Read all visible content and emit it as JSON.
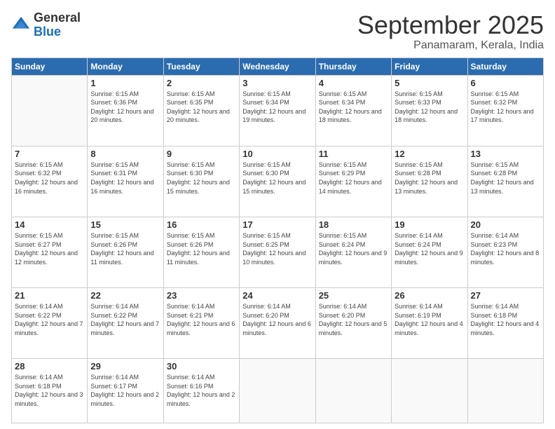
{
  "logo": {
    "general": "General",
    "blue": "Blue"
  },
  "header": {
    "month": "September 2025",
    "location": "Panamaram, Kerala, India"
  },
  "days_of_week": [
    "Sunday",
    "Monday",
    "Tuesday",
    "Wednesday",
    "Thursday",
    "Friday",
    "Saturday"
  ],
  "weeks": [
    [
      {
        "day": "",
        "info": ""
      },
      {
        "day": "1",
        "sunrise": "6:15 AM",
        "sunset": "6:36 PM",
        "daylight": "12 hours and 20 minutes."
      },
      {
        "day": "2",
        "sunrise": "6:15 AM",
        "sunset": "6:35 PM",
        "daylight": "12 hours and 20 minutes."
      },
      {
        "day": "3",
        "sunrise": "6:15 AM",
        "sunset": "6:34 PM",
        "daylight": "12 hours and 19 minutes."
      },
      {
        "day": "4",
        "sunrise": "6:15 AM",
        "sunset": "6:34 PM",
        "daylight": "12 hours and 18 minutes."
      },
      {
        "day": "5",
        "sunrise": "6:15 AM",
        "sunset": "6:33 PM",
        "daylight": "12 hours and 18 minutes."
      },
      {
        "day": "6",
        "sunrise": "6:15 AM",
        "sunset": "6:32 PM",
        "daylight": "12 hours and 17 minutes."
      }
    ],
    [
      {
        "day": "7",
        "sunrise": "6:15 AM",
        "sunset": "6:32 PM",
        "daylight": "12 hours and 16 minutes."
      },
      {
        "day": "8",
        "sunrise": "6:15 AM",
        "sunset": "6:31 PM",
        "daylight": "12 hours and 16 minutes."
      },
      {
        "day": "9",
        "sunrise": "6:15 AM",
        "sunset": "6:30 PM",
        "daylight": "12 hours and 15 minutes."
      },
      {
        "day": "10",
        "sunrise": "6:15 AM",
        "sunset": "6:30 PM",
        "daylight": "12 hours and 15 minutes."
      },
      {
        "day": "11",
        "sunrise": "6:15 AM",
        "sunset": "6:29 PM",
        "daylight": "12 hours and 14 minutes."
      },
      {
        "day": "12",
        "sunrise": "6:15 AM",
        "sunset": "6:28 PM",
        "daylight": "12 hours and 13 minutes."
      },
      {
        "day": "13",
        "sunrise": "6:15 AM",
        "sunset": "6:28 PM",
        "daylight": "12 hours and 13 minutes."
      }
    ],
    [
      {
        "day": "14",
        "sunrise": "6:15 AM",
        "sunset": "6:27 PM",
        "daylight": "12 hours and 12 minutes."
      },
      {
        "day": "15",
        "sunrise": "6:15 AM",
        "sunset": "6:26 PM",
        "daylight": "12 hours and 11 minutes."
      },
      {
        "day": "16",
        "sunrise": "6:15 AM",
        "sunset": "6:26 PM",
        "daylight": "12 hours and 11 minutes."
      },
      {
        "day": "17",
        "sunrise": "6:15 AM",
        "sunset": "6:25 PM",
        "daylight": "12 hours and 10 minutes."
      },
      {
        "day": "18",
        "sunrise": "6:15 AM",
        "sunset": "6:24 PM",
        "daylight": "12 hours and 9 minutes."
      },
      {
        "day": "19",
        "sunrise": "6:14 AM",
        "sunset": "6:24 PM",
        "daylight": "12 hours and 9 minutes."
      },
      {
        "day": "20",
        "sunrise": "6:14 AM",
        "sunset": "6:23 PM",
        "daylight": "12 hours and 8 minutes."
      }
    ],
    [
      {
        "day": "21",
        "sunrise": "6:14 AM",
        "sunset": "6:22 PM",
        "daylight": "12 hours and 7 minutes."
      },
      {
        "day": "22",
        "sunrise": "6:14 AM",
        "sunset": "6:22 PM",
        "daylight": "12 hours and 7 minutes."
      },
      {
        "day": "23",
        "sunrise": "6:14 AM",
        "sunset": "6:21 PM",
        "daylight": "12 hours and 6 minutes."
      },
      {
        "day": "24",
        "sunrise": "6:14 AM",
        "sunset": "6:20 PM",
        "daylight": "12 hours and 6 minutes."
      },
      {
        "day": "25",
        "sunrise": "6:14 AM",
        "sunset": "6:20 PM",
        "daylight": "12 hours and 5 minutes."
      },
      {
        "day": "26",
        "sunrise": "6:14 AM",
        "sunset": "6:19 PM",
        "daylight": "12 hours and 4 minutes."
      },
      {
        "day": "27",
        "sunrise": "6:14 AM",
        "sunset": "6:18 PM",
        "daylight": "12 hours and 4 minutes."
      }
    ],
    [
      {
        "day": "28",
        "sunrise": "6:14 AM",
        "sunset": "6:18 PM",
        "daylight": "12 hours and 3 minutes."
      },
      {
        "day": "29",
        "sunrise": "6:14 AM",
        "sunset": "6:17 PM",
        "daylight": "12 hours and 2 minutes."
      },
      {
        "day": "30",
        "sunrise": "6:14 AM",
        "sunset": "6:16 PM",
        "daylight": "12 hours and 2 minutes."
      },
      {
        "day": "",
        "info": ""
      },
      {
        "day": "",
        "info": ""
      },
      {
        "day": "",
        "info": ""
      },
      {
        "day": "",
        "info": ""
      }
    ]
  ]
}
